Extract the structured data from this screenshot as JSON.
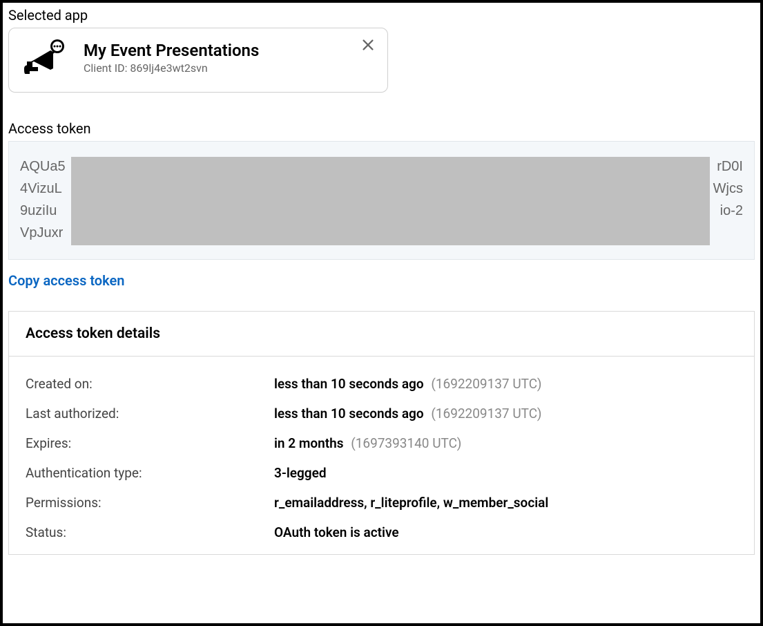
{
  "selected_app": {
    "section_label": "Selected app",
    "title": "My Event Presentations",
    "client_id_label": "Client ID:",
    "client_id_value": "869lj4e3wt2svn"
  },
  "access_token": {
    "section_label": "Access token",
    "lines": [
      {
        "left": "AQUa5",
        "right": "rD0I"
      },
      {
        "left": "4VizuL",
        "right": "Wjcs"
      },
      {
        "left": "9uziIu",
        "right": "io-2"
      },
      {
        "left": "VpJuxr",
        "right": ""
      }
    ],
    "copy_label": "Copy access token"
  },
  "details": {
    "header": "Access token details",
    "rows": [
      {
        "label": "Created on:",
        "value": "less than 10 seconds ago",
        "sub": "(1692209137 UTC)"
      },
      {
        "label": "Last authorized:",
        "value": "less than 10 seconds ago",
        "sub": "(1692209137 UTC)"
      },
      {
        "label": "Expires:",
        "value": "in 2 months",
        "sub": "(1697393140 UTC)"
      },
      {
        "label": "Authentication type:",
        "value": "3-legged",
        "sub": ""
      },
      {
        "label": "Permissions:",
        "value": "r_emailaddress, r_liteprofile, w_member_social",
        "sub": ""
      },
      {
        "label": "Status:",
        "value": "OAuth token is active",
        "sub": ""
      }
    ]
  }
}
